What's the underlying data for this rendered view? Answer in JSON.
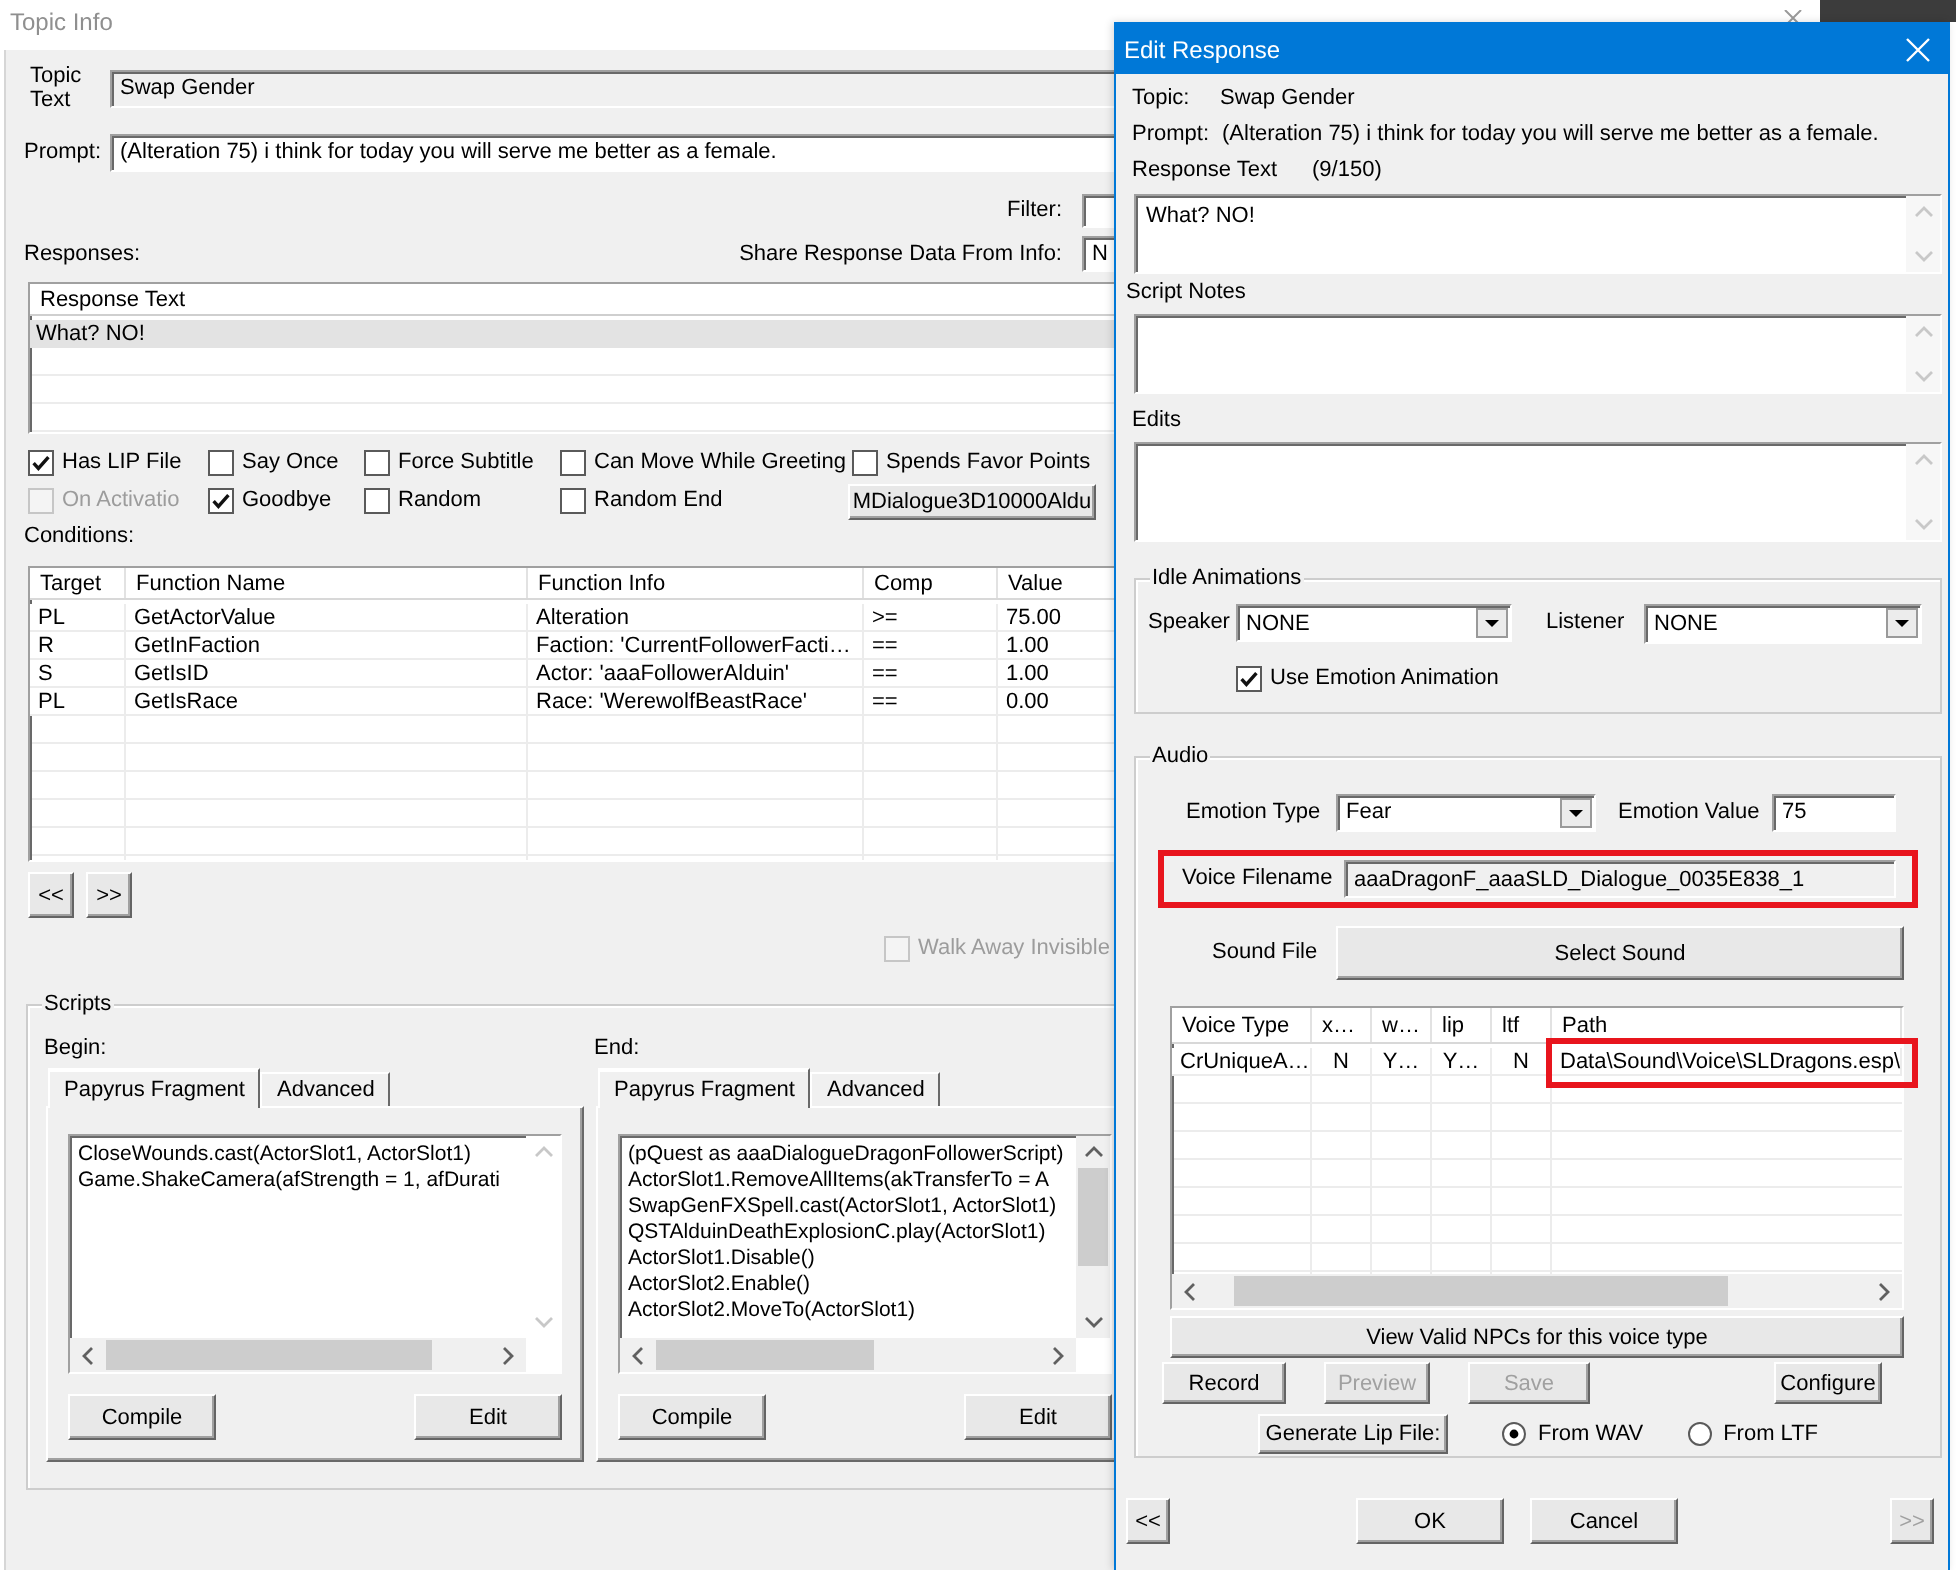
{
  "topic_info": {
    "title": "Topic Info",
    "topic_text": {
      "label": "Topic Text",
      "value": "Swap Gender"
    },
    "prompt": {
      "label": "Prompt:",
      "value": "(Alteration 75) i think for today you will serve me better as a female."
    },
    "filter": {
      "label": "Filter:"
    },
    "share_response": {
      "label": "Share Response Data From Info:",
      "value": "N"
    },
    "responses": {
      "label": "Responses:",
      "columns": [
        "Response Text"
      ],
      "rows": [
        {
          "text": "What? NO!",
          "selected": true
        }
      ]
    },
    "options": [
      {
        "label": "Has LIP File",
        "checked": true,
        "disabled": false
      },
      {
        "label": "Say Once",
        "checked": false,
        "disabled": false
      },
      {
        "label": "Force Subtitle",
        "checked": false,
        "disabled": false
      },
      {
        "label": "Can Move While Greeting",
        "checked": false,
        "disabled": false
      },
      {
        "label": "Spends Favor Points",
        "checked": false,
        "disabled": false
      },
      {
        "label": "On Activatio",
        "checked": false,
        "disabled": true
      },
      {
        "label": "Goodbye",
        "checked": true,
        "disabled": false
      },
      {
        "label": "Random",
        "checked": false,
        "disabled": false
      },
      {
        "label": "Random End",
        "checked": false,
        "disabled": false
      }
    ],
    "script_button": {
      "label": "MDialogue3D10000Aldu"
    },
    "conditions": {
      "label": "Conditions:",
      "columns": [
        "Target",
        "Function Name",
        "Function Info",
        "Comp",
        "Value"
      ],
      "rows": [
        [
          "PL",
          "GetActorValue",
          "Alteration",
          ">=",
          "75.00"
        ],
        [
          "R",
          "GetInFaction",
          "Faction: 'CurrentFollowerFacti…",
          "==",
          "1.00"
        ],
        [
          "S",
          "GetIsID",
          "Actor: 'aaaFollowerAlduin'",
          "==",
          "1.00"
        ],
        [
          "PL",
          "GetIsRace",
          "Race: 'WerewolfBeastRace'",
          "==",
          "0.00"
        ]
      ]
    },
    "nav_buttons": [
      "<<",
      ">>"
    ],
    "walk_away_invisible": {
      "label": "Walk Away Invisible",
      "checked": false,
      "disabled": true
    },
    "scripts": {
      "title": "Scripts",
      "panes": [
        {
          "label": "Begin:",
          "tabs": [
            {
              "label": "Papyrus Fragment",
              "selected": true
            },
            {
              "label": "Advanced",
              "selected": false
            }
          ],
          "lines": [
            "CloseWounds.cast(ActorSlot1, ActorSlot1)",
            "Game.ShakeCamera(afStrength = 1, afDurati"
          ],
          "buttons": [
            "Compile",
            "Edit"
          ]
        },
        {
          "label": "End:",
          "tabs": [
            {
              "label": "Papyrus Fragment",
              "selected": true
            },
            {
              "label": "Advanced",
              "selected": false
            }
          ],
          "lines": [
            "(pQuest as aaaDialogueDragonFollowerScript)",
            "ActorSlot1.RemoveAllItems(akTransferTo = A",
            "SwapGenFXSpell.cast(ActorSlot1, ActorSlot1)",
            "QSTAlduinDeathExplosionC.play(ActorSlot1)",
            "ActorSlot1.Disable()",
            "ActorSlot2.Enable()",
            "ActorSlot2.MoveTo(ActorSlot1)"
          ],
          "buttons": [
            "Compile",
            "Edit"
          ]
        }
      ]
    }
  },
  "edit_response": {
    "title": "Edit Response",
    "topic": {
      "label": "Topic:",
      "value": "Swap Gender"
    },
    "prompt": {
      "label": "Prompt:",
      "value": "(Alteration 75) i think for today you will serve me better as a female."
    },
    "response_text": {
      "label": "Response Text",
      "count": "(9/150)",
      "value": "What? NO!"
    },
    "script_notes": {
      "label": "Script Notes"
    },
    "edits": {
      "label": "Edits"
    },
    "idle_animations": {
      "title": "Idle Animations",
      "speaker": {
        "label": "Speaker",
        "value": "NONE"
      },
      "listener": {
        "label": "Listener",
        "value": "NONE"
      },
      "use_emotion": {
        "label": "Use Emotion Animation",
        "checked": true
      }
    },
    "audio": {
      "title": "Audio",
      "emotion_type": {
        "label": "Emotion Type",
        "value": "Fear"
      },
      "emotion_value": {
        "label": "Emotion Value",
        "value": "75"
      },
      "voice_filename": {
        "label": "Voice Filename",
        "value": "aaaDragonF_aaaSLD_Dialogue_0035E838_1",
        "highlighted": true
      },
      "sound_file": {
        "label": "Sound File",
        "button": "Select Sound"
      },
      "voice_table": {
        "columns": [
          "Voice Type",
          "x…",
          "w…",
          "lip",
          "ltf",
          "Path"
        ],
        "rows": [
          {
            "cells": [
              {
                "text": "CrUniqueA…",
                "highlighted": false
              },
              {
                "text": "N",
                "highlighted": false
              },
              {
                "text": "Y…",
                "highlighted": false
              },
              {
                "text": "Y…",
                "highlighted": false
              },
              {
                "text": "N",
                "highlighted": false
              },
              {
                "text": "Data\\Sound\\Voice\\SLDragons.esp\\",
                "highlighted": true
              }
            ]
          }
        ]
      },
      "view_npcs_button": "View Valid NPCs for this voice type",
      "buttons": [
        {
          "label": "Record",
          "disabled": false
        },
        {
          "label": "Preview",
          "disabled": true
        },
        {
          "label": "Save",
          "disabled": true
        },
        {
          "label": "Configure",
          "disabled": false
        }
      ],
      "generate_lip_button": "Generate Lip File:",
      "lip_source": [
        {
          "label": "From WAV",
          "selected": true
        },
        {
          "label": "From LTF",
          "selected": false
        }
      ]
    },
    "footer": {
      "prev": {
        "label": "<<",
        "disabled": false
      },
      "ok": "OK",
      "cancel": "Cancel",
      "next": {
        "label": ">>",
        "disabled": true
      }
    }
  }
}
